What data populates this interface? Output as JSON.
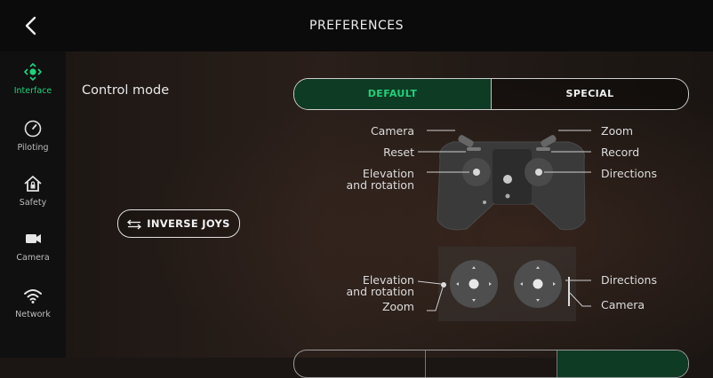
{
  "header": {
    "title": "PREFERENCES"
  },
  "sidebar": {
    "items": [
      {
        "label": "Interface",
        "icon": "interface-icon",
        "active": true
      },
      {
        "label": "Piloting",
        "icon": "gauge-icon",
        "active": false
      },
      {
        "label": "Safety",
        "icon": "home-lock-icon",
        "active": false
      },
      {
        "label": "Camera",
        "icon": "camera-icon",
        "active": false
      },
      {
        "label": "Network",
        "icon": "wifi-icon",
        "active": false
      }
    ]
  },
  "main": {
    "control_mode_label": "Control mode",
    "modes": [
      "DEFAULT",
      "SPECIAL"
    ],
    "selected_mode": "DEFAULT",
    "inverse_joys_label": "INVERSE JOYS",
    "controller_labels": {
      "camera": "Camera",
      "reset": "Reset",
      "elevation_left_1": "Elevation",
      "elevation_left_2": "and rotation",
      "zoom": "Zoom",
      "record": "Record",
      "directions": "Directions"
    },
    "joystick_labels": {
      "elevation_1": "Elevation",
      "elevation_2": "and rotation",
      "zoom": "Zoom",
      "directions": "Directions",
      "camera": "Camera"
    }
  },
  "colors": {
    "accent": "#22d07c",
    "accent_bg": "#0e3b24",
    "header_bg": "#0b0b0b",
    "sidebar_bg": "#101010"
  }
}
